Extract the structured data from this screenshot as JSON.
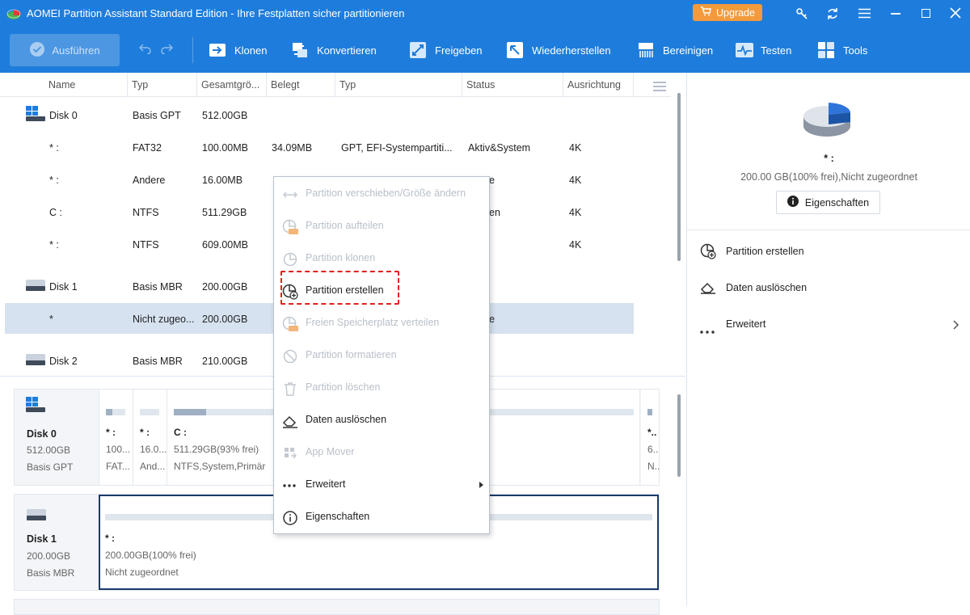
{
  "title": "AOMEI Partition Assistant Standard Edition - Ihre Festplatten sicher partitionieren",
  "upgrade_label": "Upgrade",
  "toolbar": {
    "execute": "Ausführen",
    "items": [
      "Klonen",
      "Konvertieren",
      "Freigeben",
      "Wiederherstellen",
      "Bereinigen",
      "Testen",
      "Tools"
    ]
  },
  "table": {
    "headers": [
      "Name",
      "Typ",
      "Gesamtgrö...",
      "Belegt",
      "Typ",
      "Status",
      "Ausrichtung"
    ],
    "rows": [
      {
        "name": "Disk 0",
        "typ": "Basis GPT",
        "size": "512.00GB",
        "used": "",
        "ptype": "",
        "status": "",
        "align": ""
      },
      {
        "name": "* :",
        "typ": "FAT32",
        "size": "100.00MB",
        "used": "34.09MB",
        "ptype": "GPT, EFI-Systempartiti...",
        "status": "Aktiv&System",
        "align": "4K"
      },
      {
        "name": "* :",
        "typ": "Andere",
        "size": "16.00MB",
        "used": "",
        "ptype": "",
        "status": "e",
        "align": "4K"
      },
      {
        "name": "C :",
        "typ": "NTFS",
        "size": "511.29GB",
        "used": "",
        "ptype": "",
        "status": "en",
        "align": "4K"
      },
      {
        "name": "* :",
        "typ": "NTFS",
        "size": "609.00MB",
        "used": "",
        "ptype": "",
        "status": "",
        "align": "4K"
      },
      {
        "name": "Disk 1",
        "typ": "Basis MBR",
        "size": "200.00GB",
        "used": "",
        "ptype": "",
        "status": "",
        "align": ""
      },
      {
        "name": "*",
        "typ": "Nicht zugeo...",
        "size": "200.00GB",
        "used": "",
        "ptype": "",
        "status": "e",
        "align": ""
      },
      {
        "name": "Disk 2",
        "typ": "Basis MBR",
        "size": "210.00GB",
        "used": "",
        "ptype": "",
        "status": "",
        "align": ""
      }
    ]
  },
  "context_menu": {
    "items": [
      {
        "label": "Partition verschieben/Größe ändern",
        "enabled": false
      },
      {
        "label": "Partition aufteilen",
        "enabled": false
      },
      {
        "label": "Partition klonen",
        "enabled": false
      },
      {
        "label": "Partition erstellen",
        "enabled": true
      },
      {
        "label": "Freien Speicherplatz verteilen",
        "enabled": false
      },
      {
        "label": "Partition formatieren",
        "enabled": false
      },
      {
        "label": "Partition löschen",
        "enabled": false
      },
      {
        "label": "Daten auslöschen",
        "enabled": true
      },
      {
        "label": "App Mover",
        "enabled": false
      },
      {
        "label": "Erweitert",
        "enabled": true
      },
      {
        "label": "Eigenschaften",
        "enabled": true
      }
    ]
  },
  "disk_map": {
    "disk0": {
      "name": "Disk 0",
      "size": "512.00GB",
      "type": "Basis GPT",
      "partitions": [
        {
          "label": "* :",
          "size": "100...",
          "fs": "FAT..."
        },
        {
          "label": "* :",
          "size": "16.0...",
          "fs": "And..."
        },
        {
          "label": "C :",
          "size": "511.29GB(93% frei)",
          "fs": "NTFS,System,Primär"
        },
        {
          "label": "*..",
          "size": "6..",
          "fs": "N.."
        }
      ]
    },
    "disk1": {
      "name": "Disk 1",
      "size": "200.00GB",
      "type": "Basis MBR",
      "partition": {
        "label": "* :",
        "size": "200.00GB(100% frei)",
        "fs": "Nicht zugeordnet"
      }
    }
  },
  "right_panel": {
    "part_label": "* :",
    "part_info": "200.00 GB(100% frei),Nicht zugeordnet",
    "properties_button": "Eigenschaften",
    "actions": [
      "Partition erstellen",
      "Daten auslöschen",
      "Erweitert"
    ]
  },
  "colors": {
    "accent": "#1e7ddc",
    "upgrade": "#f39a3c",
    "highlight_dashed": "#e02020",
    "selected_row": "#d6e2f0"
  }
}
